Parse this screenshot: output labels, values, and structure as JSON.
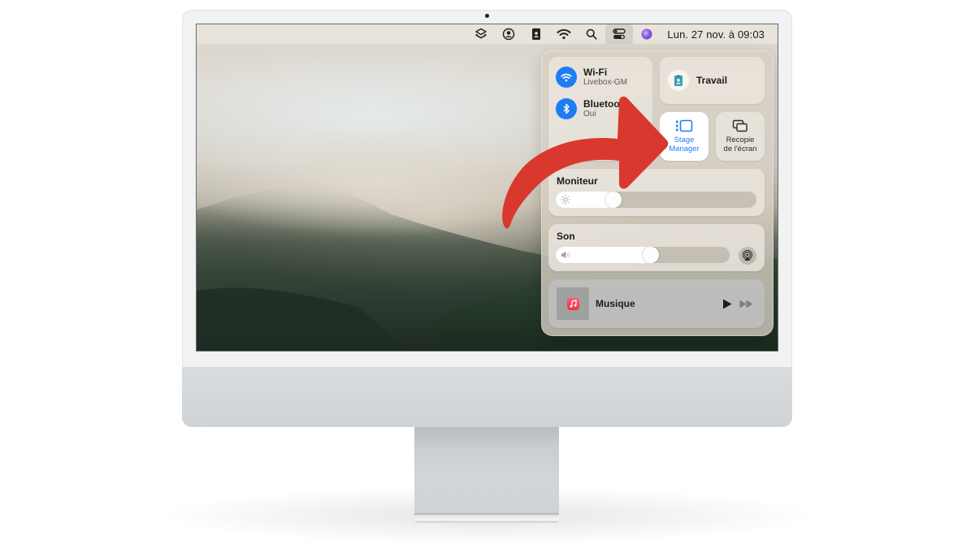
{
  "menubar": {
    "icons": [
      "shortcuts-icon",
      "user-account-icon",
      "contact-card-icon",
      "wifi-icon",
      "search-icon",
      "control-center-icon",
      "siri-icon"
    ],
    "clock": "Lun. 27 nov. à 09:03"
  },
  "control_center": {
    "wifi": {
      "title": "Wi-Fi",
      "subtitle": "Livebox-GM",
      "enabled": true
    },
    "bluetooth": {
      "title": "Bluetooth",
      "subtitle": "Oui",
      "enabled": true
    },
    "focus": {
      "label": "Travail"
    },
    "stage_manager": {
      "label_line1": "Stage",
      "label_line2": "Manager",
      "active": true
    },
    "screen_mirroring": {
      "label_line1": "Recopie",
      "label_line2": "de l'écran"
    },
    "display": {
      "heading": "Moniteur",
      "brightness_percent": 27
    },
    "sound": {
      "heading": "Son",
      "volume_percent": 55
    },
    "now_playing": {
      "app": "Musique"
    }
  },
  "colors": {
    "accent_blue": "#1f7cf3",
    "annotation_red": "#d9382e",
    "music_red": "#f42e44"
  },
  "annotation": {
    "type": "curved-arrow",
    "points_to": "stage_manager"
  }
}
